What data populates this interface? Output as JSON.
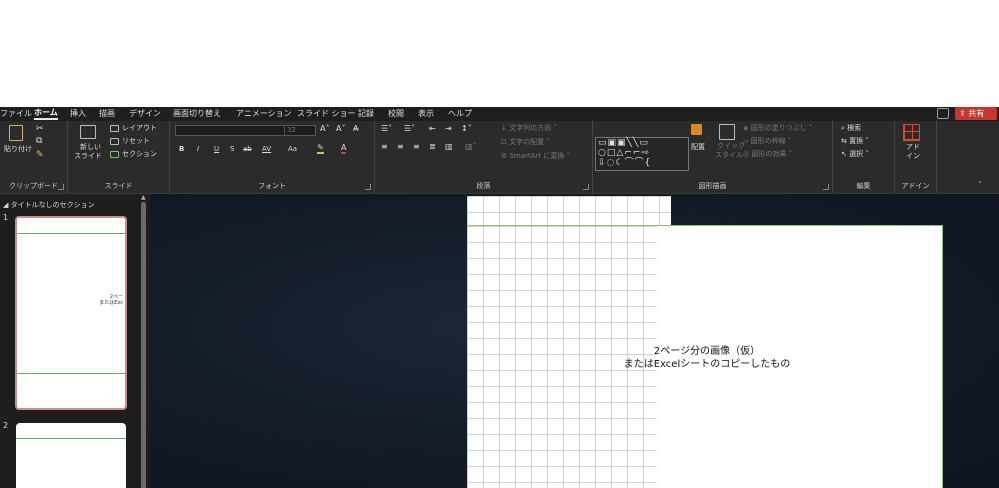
{
  "menu": {
    "tabs": [
      "ファイル",
      "ホーム",
      "挿入",
      "描画",
      "デザイン",
      "画面切り替え",
      "アニメーション",
      "スライド ショー",
      "記録",
      "校閲",
      "表示",
      "ヘルプ"
    ],
    "active_tab": "ホーム",
    "share_label": "共有"
  },
  "ribbon": {
    "clipboard": {
      "paste": "貼り付け",
      "label": "クリップボード"
    },
    "slides": {
      "new_slide_line1": "新しい",
      "new_slide_line2": "スライド",
      "layout": "レイアウト",
      "reset": "リセット",
      "section": "セクション",
      "label": "スライド"
    },
    "font": {
      "font_name": "",
      "font_size": "32",
      "case": "Aa",
      "label": "フォント",
      "buttons": [
        "B",
        "I",
        "U",
        "S",
        "ab",
        "AV"
      ]
    },
    "paragraph": {
      "text_direction": "文字列の方向",
      "align_text": "文字の配置",
      "smartart": "SmartArt に変換",
      "label": "段落"
    },
    "drawing": {
      "arrange": "配置",
      "quick_styles_line1": "クイック",
      "quick_styles_line2": "スタイル",
      "shape_fill": "図形の塗りつぶし",
      "shape_outline": "図形の枠線",
      "shape_effects": "図形の効果",
      "label": "図形描画"
    },
    "editing": {
      "find": "検索",
      "replace": "置換",
      "select": "選択",
      "label": "編集"
    },
    "addins": {
      "button_line1": "アド",
      "button_line2": "イン",
      "label": "アドイン"
    }
  },
  "thumbnails": {
    "section_title": "タイトルなしのセクション",
    "slides": [
      {
        "number": "1",
        "text_line1": "2ペー",
        "text_line2": "またはExc"
      },
      {
        "number": "2"
      }
    ]
  },
  "slide": {
    "caption_line1": "2ページ分の画像（仮）",
    "caption_line2": "またはExcelシートのコピーしたもの"
  },
  "colors": {
    "share_button": "#c4372e",
    "selection_border": "#c98b8b",
    "guide_line": "#8fbf7f",
    "canvas_bg": "#121a26"
  }
}
